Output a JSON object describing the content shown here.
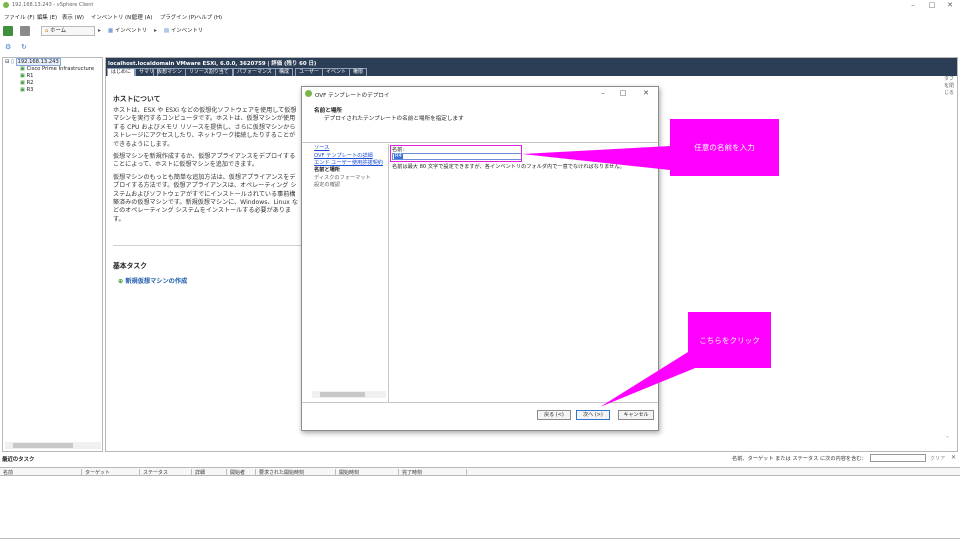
{
  "window": {
    "title": "192.168.13.243 - vSphere Client",
    "controls": [
      "–",
      "□",
      "✕"
    ]
  },
  "menu": [
    "ファイル (F)",
    "編集 (E)",
    "表示 (W)",
    "インベントリ (N)",
    "管理 (A)",
    "プラグイン (P)",
    "ヘルプ (H)"
  ],
  "nav": {
    "home": "ホーム",
    "inventory1": "インベントリ",
    "inventory2": "インベントリ"
  },
  "tree": {
    "root": "192.168.13.243",
    "items": [
      "Cisco Prime Infrastructure",
      "R1",
      "R2",
      "R3"
    ]
  },
  "host": {
    "title": "localhost.localdomain VMware ESXi, 6.0.0, 3620759 | 評価 (残り 60 日)",
    "tabs": [
      "はじめに",
      "サマリ",
      "仮想マシン",
      "リソース割り当て",
      "パフォーマンス",
      "構成",
      "ユーザー",
      "イベント",
      "権限"
    ],
    "close_tab": "タブを閉じる"
  },
  "about": {
    "heading": "ホストについて",
    "p1": "ホストは、ESX や ESXi などの仮想化ソフトウェアを使用して仮想マシンを実行するコンピュータです。ホストは、仮想マシンが使用する CPU およびメモリ リソースを提供し、さらに仮想マシンからストレージにアクセスしたり、ネットワーク接続したりすることができるようにします。",
    "p2": "仮想マシンを新規作成するか、仮想アプライアンスをデプロイすることによって、ホストに仮想マシンを追加できます。",
    "p3": "仮想マシンのもっとも簡単な追加方法は、仮想アプライアンスをデプロイする方法です。仮想アプライアンスは、オペレーティング システムおよびソフトウェアがすでにインストールされている事前構築済みの仮想マシンです。新規仮想マシンに、Windows、Linux などのオペレーティング システムをインストールする必要があります。",
    "basic_tasks": "基本タスク",
    "task1": "新規仮想マシンの作成"
  },
  "dialog": {
    "title": "OVF テンプレートのデプロイ",
    "header_bold": "名前と場所",
    "header_sub": "デプロイされたテンプレートの名前と場所を指定します",
    "steps": [
      {
        "label": "ソース",
        "state": "link"
      },
      {
        "label": "OVF テンプレートの詳細",
        "state": "link"
      },
      {
        "label": "エンド ユーザー使用許諾契約",
        "state": "link"
      },
      {
        "label": "名前と場所",
        "state": "current"
      },
      {
        "label": "ディスクのフォーマット",
        "state": "off"
      },
      {
        "label": "設定の確認",
        "state": "off"
      }
    ],
    "name_label": "名前:",
    "name_value": "R4",
    "help": "名前は最大 80 文字で設定できますが、各インベントリのフォルダ内で一意でなければなりません。",
    "buttons": {
      "back": "戻る (<)",
      "next": "次へ (>)",
      "cancel": "キャンセル"
    },
    "controls": [
      "–",
      "□",
      "✕"
    ]
  },
  "callouts": {
    "enter_name": "任意の名前を入力",
    "click_here": "こちらをクリック"
  },
  "recent": {
    "title": "最近のタスク",
    "filter_label": "名前、ターゲット または ステータス に次の内容を含む：",
    "clear": "クリア",
    "columns": [
      "名前",
      "ターゲット",
      "ステータス",
      "詳細",
      "開始者",
      "要求された開始時刻",
      "開始時刻",
      "完了時刻"
    ]
  },
  "colors": {
    "accent": "#ff00ff",
    "hostbar": "#2c3e55",
    "link": "#1f4fd6"
  }
}
